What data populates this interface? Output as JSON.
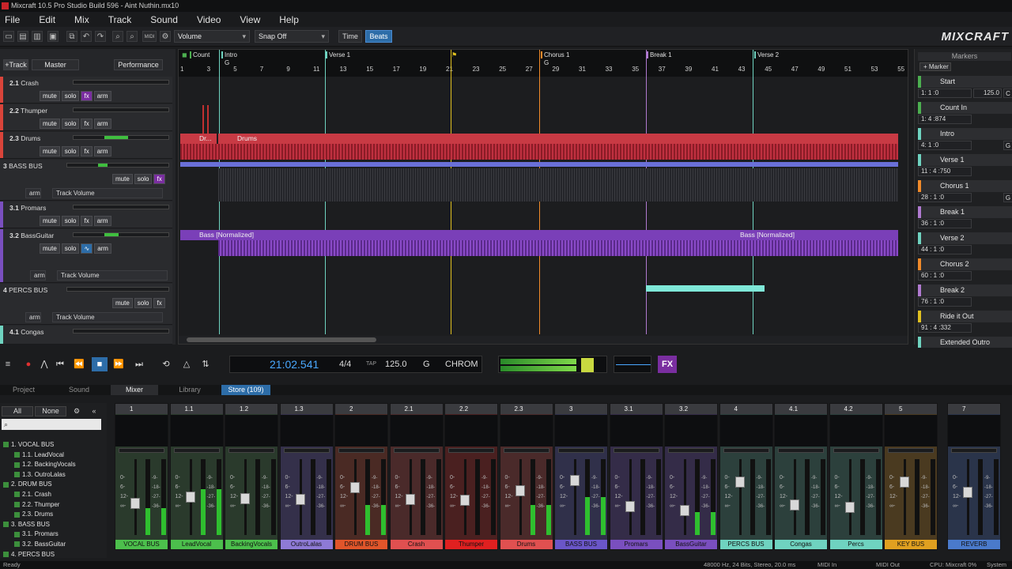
{
  "window": {
    "title": "Mixcraft 10.5 Pro Studio Build 596 - Aint Nuthin.mx10"
  },
  "menu": [
    "File",
    "Edit",
    "Mix",
    "Track",
    "Sound",
    "Video",
    "View",
    "Help"
  ],
  "toolbar": {
    "param": "Volume",
    "snap": "Snap Off",
    "time": "Time",
    "beats": "Beats",
    "brand": "MIXCRAFT",
    "midi_label": "MIDI"
  },
  "trackpanel": {
    "add": "+Track",
    "master": "Master",
    "performance": "Performance",
    "mute": "mute",
    "solo": "solo",
    "fx": "fx",
    "arm": "arm",
    "track_volume": "Track Volume"
  },
  "tracks": [
    {
      "num": "2.1",
      "name": "Crash",
      "color": "#d9443a"
    },
    {
      "num": "2.2",
      "name": "Thumper",
      "color": "#d9443a"
    },
    {
      "num": "2.3",
      "name": "Drums",
      "color": "#d9443a"
    },
    {
      "num": "3",
      "name": "BASS BUS",
      "color": "#6a56c8"
    },
    {
      "num": "3.1",
      "name": "Promars",
      "color": "#7a4fbf"
    },
    {
      "num": "3.2",
      "name": "BassGuitar",
      "color": "#7a4fbf"
    },
    {
      "num": "4",
      "name": "PERCS BUS",
      "color": "#6fd3c0"
    },
    {
      "num": "4.1",
      "name": "Congas",
      "color": "#6fd3c0"
    }
  ],
  "ruler": {
    "ticks": [
      "1",
      "3",
      "5",
      "7",
      "9",
      "11",
      "13",
      "15",
      "17",
      "19",
      "21",
      "23",
      "25",
      "27",
      "29",
      "31",
      "33",
      "35",
      "37",
      "39",
      "41",
      "43",
      "45",
      "47",
      "49",
      "51",
      "53",
      "55"
    ],
    "markers": [
      {
        "label": "Count",
        "color": "#4caf50"
      },
      {
        "label": "Intro",
        "color": "#6fd3c0"
      },
      {
        "label": "Verse 1",
        "color": "#6fd3c0"
      },
      {
        "label": "Chorus 1",
        "color": "#f08a2a"
      },
      {
        "label": "Break 1",
        "color": "#b07ad0"
      },
      {
        "label": "Verse 2",
        "color": "#6fd3c0"
      }
    ],
    "g1": "G",
    "g2": "G"
  },
  "clips": {
    "drums_a": "Dr...",
    "drums_b": "Drums",
    "bass_a": "Bass [Normalized]",
    "bass_b": "Bass [Normalized]"
  },
  "markerspanel": {
    "title": "Markers",
    "add": "+ Marker",
    "items": [
      {
        "name": "Start",
        "pos": "1: 1 :0",
        "tempo": "125.0",
        "key": "C",
        "color": "#4caf50"
      },
      {
        "name": "Count In",
        "pos": "1: 4 :874",
        "tempo": "",
        "key": "",
        "color": "#4caf50"
      },
      {
        "name": "Intro",
        "pos": "4: 1 :0",
        "tempo": "",
        "key": "G",
        "color": "#6fd3c0"
      },
      {
        "name": "Verse 1",
        "pos": "11 : 4 :750",
        "tempo": "",
        "key": "",
        "color": "#6fd3c0"
      },
      {
        "name": "Chorus 1",
        "pos": "28 : 1 :0",
        "tempo": "",
        "key": "G",
        "color": "#f08a2a"
      },
      {
        "name": "Break 1",
        "pos": "36 : 1 :0",
        "tempo": "",
        "key": "",
        "color": "#b07ad0"
      },
      {
        "name": "Verse 2",
        "pos": "44 : 1 :0",
        "tempo": "",
        "key": "",
        "color": "#6fd3c0"
      },
      {
        "name": "Chorus 2",
        "pos": "60 : 1 :0",
        "tempo": "",
        "key": "",
        "color": "#f08a2a"
      },
      {
        "name": "Break 2",
        "pos": "76 : 1 :0",
        "tempo": "",
        "key": "",
        "color": "#b07ad0"
      },
      {
        "name": "Ride it Out",
        "pos": "91 : 4 :332",
        "tempo": "",
        "key": "",
        "color": "#e0c020"
      },
      {
        "name": "Extended Outro",
        "pos": "",
        "tempo": "",
        "key": "",
        "color": "#6fd3c0"
      }
    ]
  },
  "transport": {
    "time": "21:02.541",
    "signature": "4/4",
    "tap": "TAP",
    "tempo": "125.0",
    "key": "G",
    "scale": "CHROM",
    "fx": "FX"
  },
  "bottomtabs": [
    "Project",
    "Sound",
    "Mixer",
    "Library",
    "Store (109)"
  ],
  "mixleft": {
    "all": "All",
    "none": "None",
    "tree": [
      "1. VOCAL BUS",
      "1.1. LeadVocal",
      "1.2. BackingVocals",
      "1.3. OutroLalas",
      "2. DRUM BUS",
      "2.1. Crash",
      "2.2. Thumper",
      "2.3. Drums",
      "3. BASS BUS",
      "3.1. Promars",
      "3.2. BassGuitar",
      "4. PERCS BUS"
    ]
  },
  "strips": [
    {
      "num": "1",
      "name": "VOCAL BUS",
      "color": "#4cbf4c",
      "vu": 0.35
    },
    {
      "num": "1.1",
      "name": "LeadVocal",
      "color": "#4cbf4c",
      "vu": 0.6
    },
    {
      "num": "1.2",
      "name": "BackingVocals",
      "color": "#4cbf4c",
      "vu": 0.0
    },
    {
      "num": "1.3",
      "name": "OutroLalas",
      "color": "#8e7ad6",
      "vu": 0.0
    },
    {
      "num": "2",
      "name": "DRUM BUS",
      "color": "#e0552a",
      "vu": 0.4
    },
    {
      "num": "2.1",
      "name": "Crash",
      "color": "#e05050",
      "vu": 0.0
    },
    {
      "num": "2.2",
      "name": "Thumper",
      "color": "#e02020",
      "vu": 0.0
    },
    {
      "num": "2.3",
      "name": "Drums",
      "color": "#e05050",
      "vu": 0.4
    },
    {
      "num": "3",
      "name": "BASS BUS",
      "color": "#6a56c8",
      "vu": 0.5
    },
    {
      "num": "3.1",
      "name": "Promars",
      "color": "#7a4fbf",
      "vu": 0.0
    },
    {
      "num": "3.2",
      "name": "BassGuitar",
      "color": "#7a4fbf",
      "vu": 0.3
    },
    {
      "num": "4",
      "name": "PERCS BUS",
      "color": "#6fd3c0",
      "vu": 0.0
    },
    {
      "num": "4.1",
      "name": "Congas",
      "color": "#6fd3c0",
      "vu": 0.0
    },
    {
      "num": "4.2",
      "name": "Percs",
      "color": "#6fd3c0",
      "vu": 0.0
    },
    {
      "num": "5",
      "name": "KEY BUS",
      "color": "#e0a020",
      "vu": 0.0
    },
    {
      "num": "7",
      "name": "REVERB",
      "color": "#4a7acb",
      "vu": 0.0
    }
  ],
  "scale": [
    "0-",
    "6-",
    "12-",
    "∞-"
  ],
  "scale_r": [
    "-9-",
    "-18-",
    "-27-",
    "-36-"
  ],
  "status": {
    "left": "Ready",
    "audio": "48000 Hz, 24 Bits, Stereo, 20.0 ms",
    "midi_in": "MIDI In",
    "midi_out": "MIDI Out",
    "cpu": "CPU: Mixcraft 0%",
    "sys": "System"
  }
}
